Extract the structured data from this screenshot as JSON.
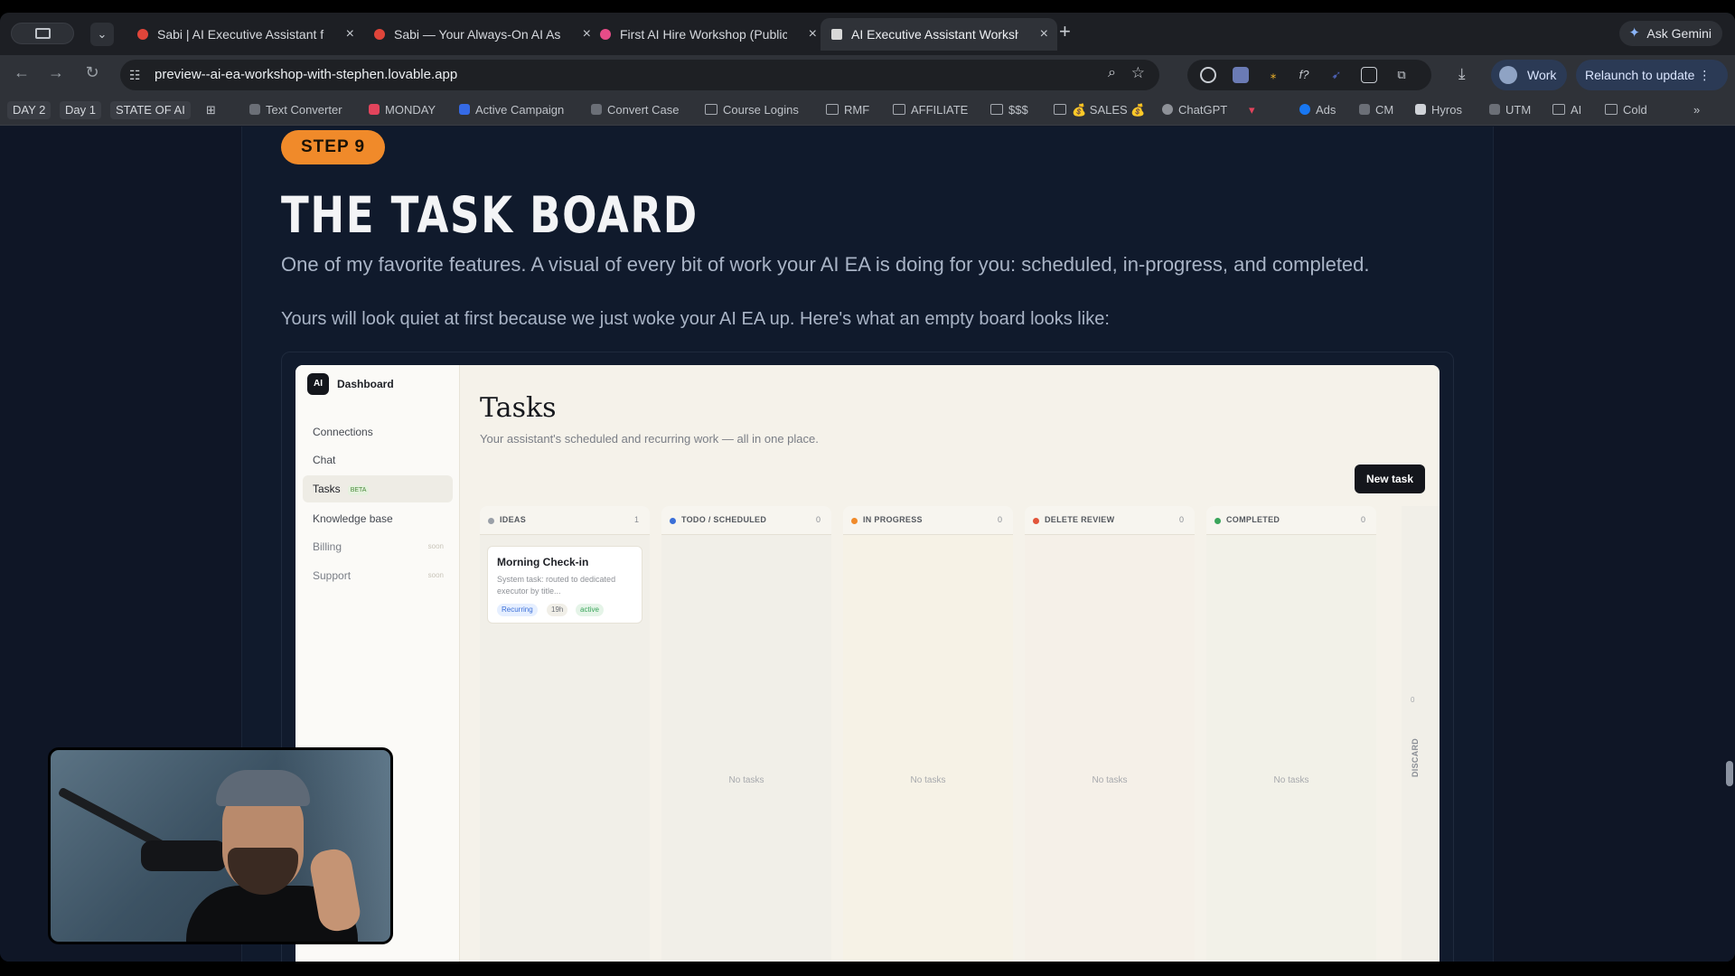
{
  "browser": {
    "tabs": [
      {
        "title": "Sabi | AI Executive Assistant f",
        "color": "#e0453a"
      },
      {
        "title": "Sabi — Your Always-On AI As",
        "color": "#e0453a"
      },
      {
        "title": "First AI Hire Workshop (Public",
        "color": "#e74c88"
      },
      {
        "title": "AI Executive Assistant Worksh",
        "color": "#d8d8d8"
      }
    ],
    "ask_gemini": "Ask Gemini",
    "url": "preview--ai-ea-workshop-with-stephen.lovable.app",
    "profile": "Work",
    "relaunch": "Relaunch to update",
    "bookmarks": [
      "DAY 2",
      "Day 1",
      "STATE OF AI",
      "Text Converter",
      "MONDAY",
      "Active Campaign",
      "Convert Case",
      "Course Logins",
      "RMF",
      "AFFILIATE",
      "$$$",
      "💰 SALES 💰",
      "ChatGPT",
      "Ads",
      "CM",
      "Hyros",
      "UTM",
      "AI",
      "Cold"
    ]
  },
  "page": {
    "step_badge": "STEP 9",
    "heading": "THE TASK BOARD",
    "paragraph1": "One of my favorite features. A visual of every bit of work your AI EA is doing for you: scheduled, in-progress, and completed.",
    "paragraph2": "Yours will look quiet at first because we just woke your AI EA up. Here's what an empty board looks like:"
  },
  "dashboard": {
    "logo": "AI",
    "brand": "Dashboard",
    "nav": [
      {
        "label": "Connections"
      },
      {
        "label": "Chat"
      },
      {
        "label": "Tasks",
        "badge": "BETA"
      },
      {
        "label": "Knowledge base"
      },
      {
        "label": "Billing",
        "soon": "soon"
      },
      {
        "label": "Support",
        "soon": "soon"
      }
    ],
    "title": "Tasks",
    "subtitle": "Your assistant's scheduled and recurring work — all in one place.",
    "new_task": "New task",
    "columns": [
      {
        "name": "IDEAS",
        "count": "1",
        "color": "#9aa0a8"
      },
      {
        "name": "TODO / SCHEDULED",
        "count": "0",
        "color": "#3b6fd8"
      },
      {
        "name": "IN PROGRESS",
        "count": "0",
        "color": "#f08a2a"
      },
      {
        "name": "DELETE REVIEW",
        "count": "0",
        "color": "#e2553a"
      },
      {
        "name": "COMPLETED",
        "count": "0",
        "color": "#3aa55b"
      }
    ],
    "empty_label": "No tasks",
    "card": {
      "title": "Morning Check-in",
      "desc": "System task: routed to dedicated executor by title...",
      "tags": [
        "Recurring",
        "19h",
        "active"
      ]
    },
    "discard": {
      "label": "DISCARD",
      "count": "0"
    }
  }
}
